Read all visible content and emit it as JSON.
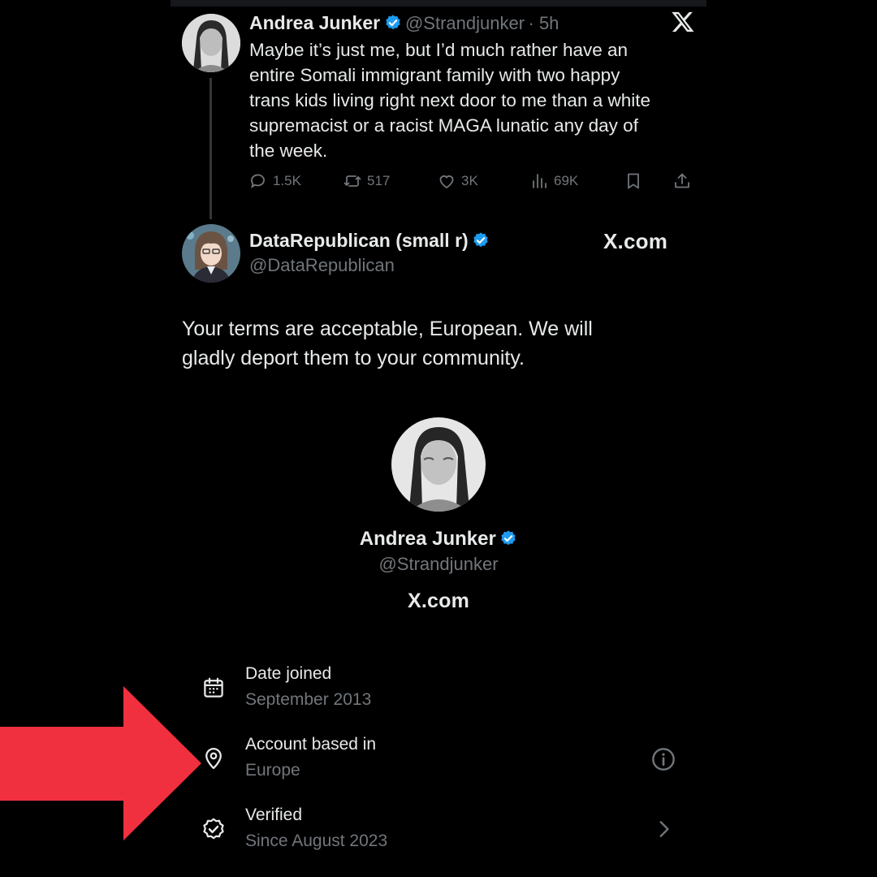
{
  "tweet1": {
    "name": "Andrea Junker",
    "handle": "@Strandjunker",
    "time": "· 5h",
    "text_lines": [
      "Maybe it’s just me, but I’d much rather have an",
      "entire Somali immigrant family with two happy",
      "trans kids living right next door to me than a white",
      "supremacist or a racist MAGA lunatic any day of",
      "the week."
    ],
    "metrics": {
      "replies": "1.5K",
      "reposts": "517",
      "likes": "3K",
      "views": "69K"
    }
  },
  "logo_top": "X",
  "tweet2": {
    "name": "DataRepublican (small r)",
    "handle": "@DataRepublican",
    "brand": "X.com",
    "text_lines": [
      "Your terms are acceptable, European. We will",
      "gladly deport them to your community."
    ]
  },
  "profile_card": {
    "name": "Andrea Junker",
    "handle": "@Strandjunker",
    "brand": "X.com"
  },
  "about": [
    {
      "icon": "calendar-icon",
      "title": "Date joined",
      "value": "September 2013"
    },
    {
      "icon": "location-pin-icon",
      "title": "Account based in",
      "value": "Europe",
      "action_icon": "info-icon"
    },
    {
      "icon": "verified-badge-icon",
      "title": "Verified",
      "value": "Since August 2023",
      "action_icon": "chevron-right-icon"
    }
  ],
  "colors": {
    "verified_blue": "#1d9bf0",
    "arrow_red": "#f0303f",
    "muted_text": "#71767b"
  }
}
